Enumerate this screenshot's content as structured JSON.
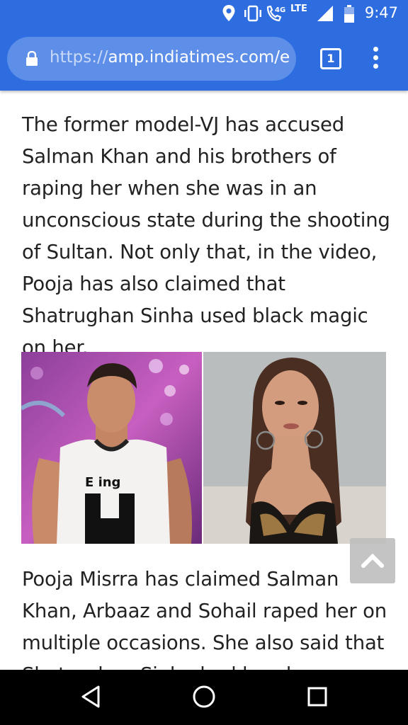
{
  "status_bar": {
    "time": "9:47",
    "network_label": "LTE",
    "network_sub_label": "4G",
    "icons": [
      "location-icon",
      "vibrate-icon",
      "wifi-calling-icon",
      "signal-icon",
      "battery-icon"
    ]
  },
  "browser": {
    "url_scheme": "https://",
    "url_host": "amp.indiatimes.com/e",
    "tab_count": "1",
    "toolbar_color": "#2d6de0"
  },
  "article": {
    "paragraph_1": "The former model-VJ has accused Salman Khan and his brothers of raping her when she was in an unconscious state during the shooting of Sultan. Not only that, in the video, Pooja has also claimed that Shatrughan Sinha used black magic on her.",
    "image_left_text": "E ing",
    "paragraph_2": "Pooja Misrra has claimed Salman Khan, Arbaaz and Sohail raped her on multiple occasions. She also said that Shatrughan Sinha had lured..."
  },
  "nav_bar": {
    "icons": [
      "back-icon",
      "home-icon",
      "recents-icon"
    ]
  }
}
